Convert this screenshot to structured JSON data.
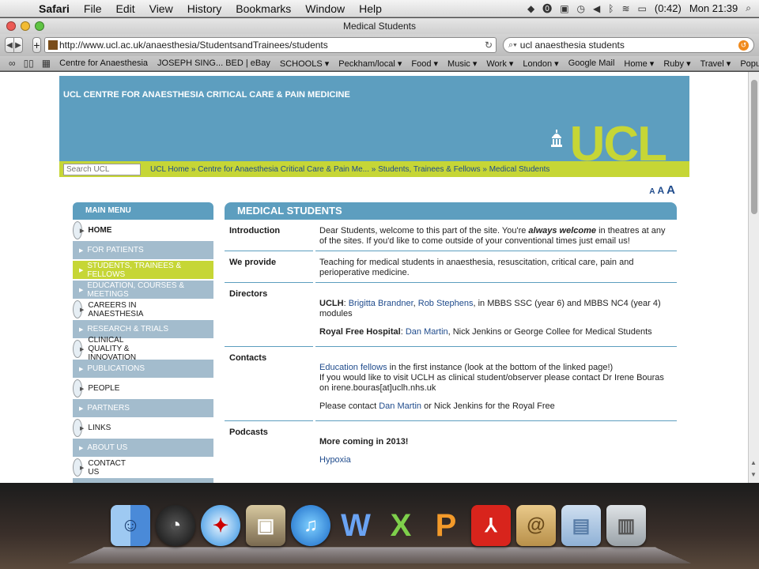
{
  "menubar": {
    "app": "Safari",
    "items": [
      "File",
      "Edit",
      "View",
      "History",
      "Bookmarks",
      "Window",
      "Help"
    ],
    "battery": "(0:42)",
    "clock": "Mon 21:39"
  },
  "window": {
    "title": "Medical Students"
  },
  "toolbar": {
    "url": "http://www.ucl.ac.uk/anaesthesia/StudentsandTrainees/students",
    "search": "ucl anaesthesia students"
  },
  "bookmarks": [
    "Centre for Anaesthesia",
    "JOSEPH SING... BED | eBay",
    "SCHOOLS ▾",
    "Peckham/local ▾",
    "Food ▾",
    "Music ▾",
    "Work ▾",
    "London ▾",
    "Google Mail",
    "Home ▾",
    "Ruby ▾",
    "Travel ▾",
    "Popular ▾"
  ],
  "site": {
    "dept": "UCL CENTRE FOR ANAESTHESIA CRITICAL CARE & PAIN MEDICINE",
    "logo": "UCL",
    "search_placeholder": "Search UCL",
    "breadcrumb": "UCL Home » Centre for Anaesthesia Critical Care & Pain Me... » Students, Trainees & Fellows » Medical Students",
    "textsize": [
      "A",
      "A",
      "A"
    ]
  },
  "menu": {
    "title": "MAIN MENU",
    "items": [
      "HOME",
      "FOR PATIENTS",
      "STUDENTS, TRAINEES & FELLOWS",
      "EDUCATION, COURSES & MEETINGS",
      "CAREERS IN ANAESTHESIA",
      "RESEARCH & TRIALS",
      "CLINICAL QUALITY & INNOVATION",
      "PUBLICATIONS",
      "PEOPLE",
      "PARTNERS",
      "LINKS",
      "ABOUT US",
      "CONTACT US"
    ]
  },
  "content": {
    "title": "MEDICAL STUDENTS",
    "intro_label": "Introduction",
    "intro_a": "Dear Students, welcome to this part of the site. You're ",
    "intro_em": "always welcome",
    "intro_b": " in theatres at any of the sites.  If you'd like to come outside of your conventional times just email us!",
    "provide_label": "We provide",
    "provide_text": "Teaching for medical students in anaesthesia, resuscitation, critical care, pain and perioperative medicine.",
    "directors_label": "Directors",
    "uclh_label": "UCLH",
    "uclh_sep": ": ",
    "uclh_link1": "Brigitta Brandner",
    "uclh_comma": ",  ",
    "uclh_link2": "Rob Stephens",
    "uclh_rest": ",  in MBBS SSC (year 6) and MBBS NC4 (year 4) modules",
    "rf_label": "Royal Free Hospital",
    "rf_sep": ": ",
    "rf_link": "Dan Martin",
    "rf_rest": ", Nick Jenkins or George Collee for Medical Students",
    "contacts_label": "Contacts",
    "contacts_link": "Education fellows",
    "contacts_a": " in the first instance (look at the bottom of the linked page!)",
    "contacts_b": "If you would like to visit UCLH as clinical student/observer please contact Dr Irene Bouras on irene.bouras[at]uclh.nhs.uk",
    "contacts_c1": "Please contact ",
    "contacts_c_link": "Dan Martin",
    "contacts_c2": " or Nick Jenkins for the Royal Free",
    "podcasts_label": "Podcasts",
    "podcasts_coming": "More coming in 2013!",
    "podcasts_link": "Hypoxia"
  }
}
